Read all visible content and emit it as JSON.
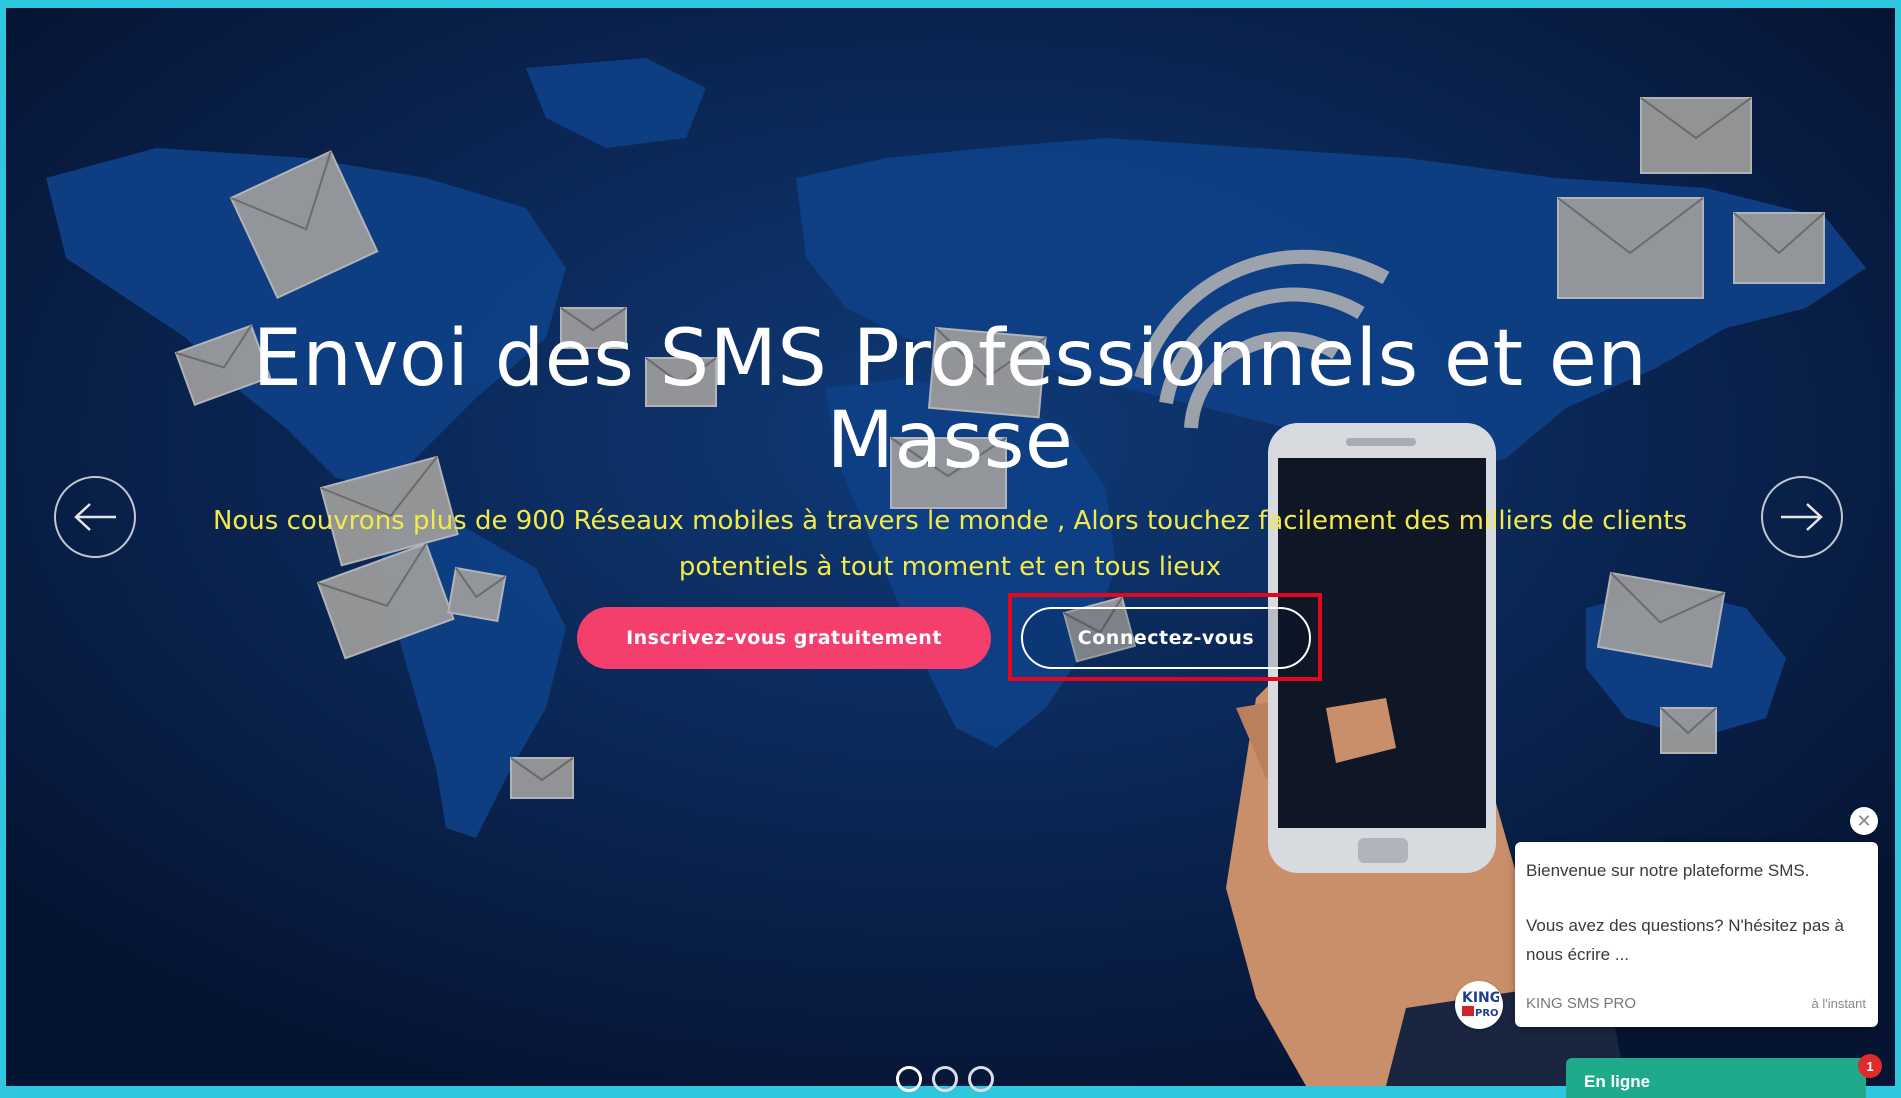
{
  "hero": {
    "title_line1": "Envoi des SMS Professionnels et en",
    "title_line2": "Masse",
    "subtitle_line1": "Nous couvrons plus de 900 Réseaux mobiles à travers le monde , Alors touchez facilement des milliers de clients",
    "subtitle_line2": "potentiels à tout moment et en tous lieux",
    "signup_label": "Inscrivez-vous gratuitement",
    "login_label": "Connectez-vous"
  },
  "carousel": {
    "prev_icon": "arrow-left-icon",
    "next_icon": "arrow-right-icon",
    "slides": 3,
    "active_slide": 1
  },
  "chat": {
    "close_icon": "close-icon",
    "message_line1": "Bienvenue sur notre plateforme SMS.",
    "message_line2": "Vous avez des questions? N'hésitez pas à nous écrire ...",
    "agent_name": "KING SMS PRO",
    "time": "à l'instant",
    "status": "En ligne",
    "badge_count": "1"
  },
  "colors": {
    "primary": "#f43f6c",
    "subtitle": "#f3e94a",
    "background": "#061433",
    "online": "#1faa8b",
    "highlight": "#e3061d"
  }
}
